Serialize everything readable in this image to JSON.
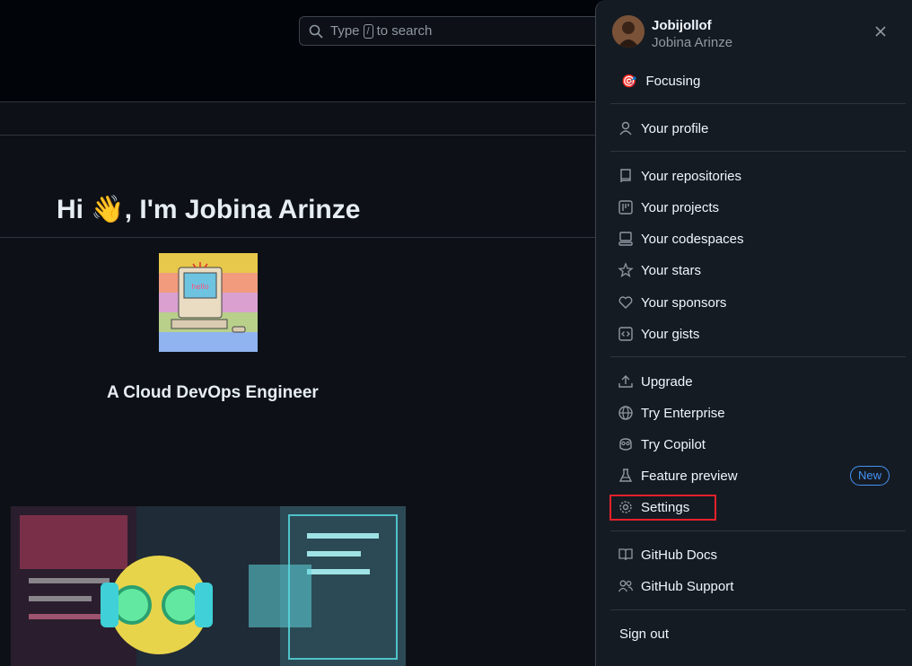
{
  "search": {
    "text_before": "Type",
    "key": "/",
    "text_after": "to search"
  },
  "profile": {
    "greeting": "Hi 👋, I'm Jobina Arinze",
    "tagline": "A Cloud DevOps Engineer",
    "hello_text": "hello"
  },
  "menu": {
    "login": "Jobijollof",
    "full_name": "Jobina Arinze",
    "status": "Focusing",
    "status_emoji": "🎯",
    "items": {
      "profile": "Your profile",
      "repositories": "Your repositories",
      "projects": "Your projects",
      "codespaces": "Your codespaces",
      "stars": "Your stars",
      "sponsors": "Your sponsors",
      "gists": "Your gists",
      "upgrade": "Upgrade",
      "enterprise": "Try Enterprise",
      "copilot": "Try Copilot",
      "feature_preview": "Feature preview",
      "settings": "Settings",
      "docs": "GitHub Docs",
      "support": "GitHub Support",
      "sign_out": "Sign out"
    },
    "new_badge": "New"
  },
  "colors": {
    "background": "#0d1117",
    "menu": "#151b23",
    "accent": "#4493f8",
    "highlight": "#e5212a"
  }
}
